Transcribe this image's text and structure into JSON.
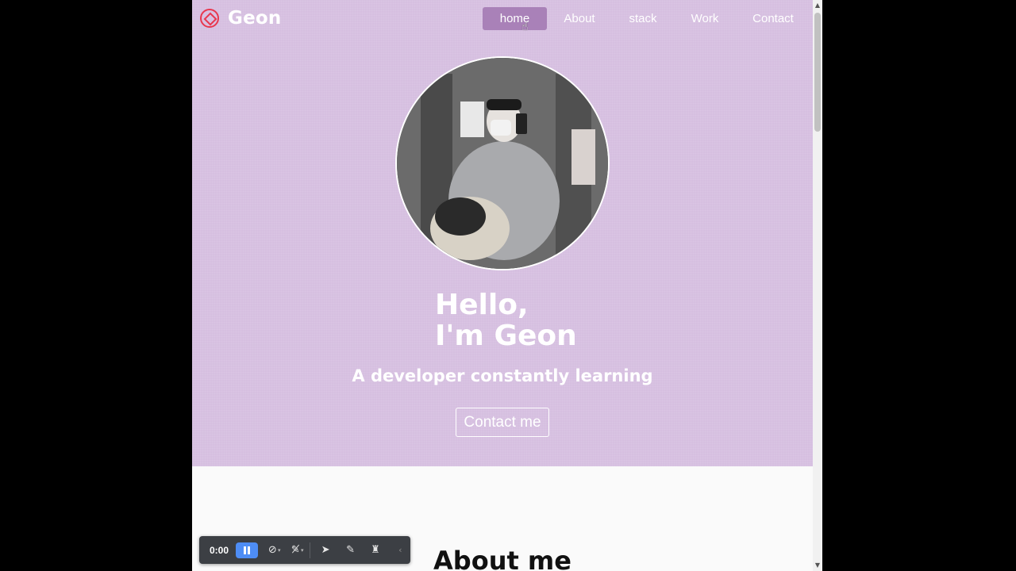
{
  "brand": {
    "name": "Geon",
    "icon": "diamond-code-icon",
    "accent": "#e8384f"
  },
  "nav": {
    "items": [
      {
        "label": "home",
        "active": true
      },
      {
        "label": "About",
        "active": false
      },
      {
        "label": "stack",
        "active": false
      },
      {
        "label": "Work",
        "active": false
      },
      {
        "label": "Contact",
        "active": false
      }
    ]
  },
  "hero": {
    "greeting_line1": "Hello,",
    "greeting_line2": "I'm Geon",
    "tagline": "A developer constantly learning",
    "cta_label": "Contact me",
    "background": "#d6bfe0"
  },
  "about": {
    "title": "About me"
  },
  "recorder": {
    "time": "0:00",
    "buttons": [
      "pause-icon",
      "camera-off-icon",
      "mic-off-icon",
      "pointer-icon",
      "pen-icon",
      "broom-icon",
      "collapse-icon"
    ]
  }
}
